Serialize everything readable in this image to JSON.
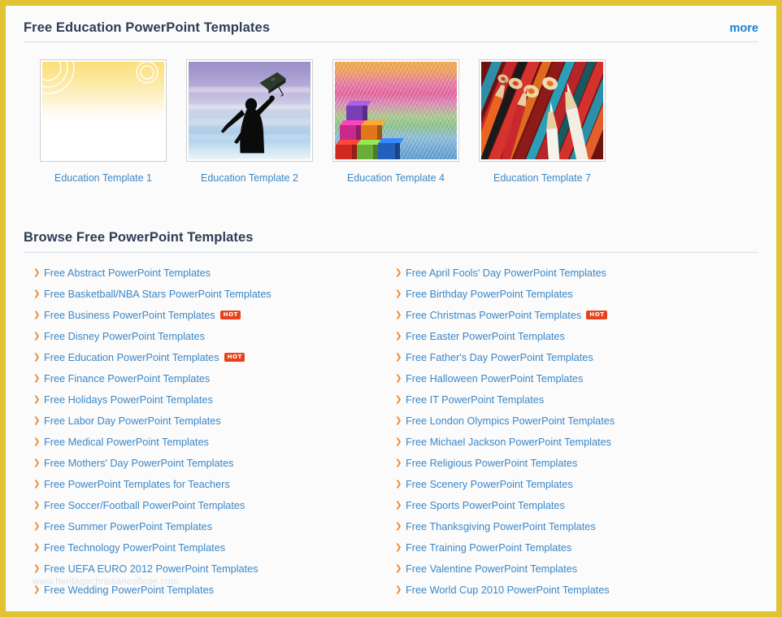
{
  "featured": {
    "title": "Free Education PowerPoint Templates",
    "more_label": "more",
    "more_color": "#1d7fd4",
    "thumbnails": [
      {
        "caption": "Education Template 1",
        "style": "yellow-swirl"
      },
      {
        "caption": "Education Template 2",
        "style": "graduate-silhouette"
      },
      {
        "caption": "Education Template 4",
        "style": "rainbow-blocks"
      },
      {
        "caption": "Education Template 7",
        "style": "colored-pencils"
      }
    ]
  },
  "browse": {
    "title": "Browse Free PowerPoint Templates",
    "bullet_glyph": "❯",
    "bullet_color": "#e8882a",
    "link_color": "#3b87c7",
    "hot_label": "HOT",
    "hot_color": "#e8421d",
    "left_column": [
      {
        "label": "Free Abstract PowerPoint Templates",
        "hot": false
      },
      {
        "label": "Free Basketball/NBA Stars PowerPoint Templates",
        "hot": false
      },
      {
        "label": "Free Business PowerPoint Templates",
        "hot": true
      },
      {
        "label": "Free Disney PowerPoint Templates",
        "hot": false
      },
      {
        "label": "Free Education PowerPoint Templates",
        "hot": true
      },
      {
        "label": "Free Finance PowerPoint Templates",
        "hot": false
      },
      {
        "label": "Free Holidays PowerPoint Templates",
        "hot": false
      },
      {
        "label": "Free Labor Day PowerPoint Templates",
        "hot": false
      },
      {
        "label": "Free Medical PowerPoint Templates",
        "hot": false
      },
      {
        "label": "Free Mothers' Day PowerPoint Templates",
        "hot": false
      },
      {
        "label": "Free PowerPoint Templates for Teachers",
        "hot": false
      },
      {
        "label": "Free Soccer/Football PowerPoint Templates",
        "hot": false
      },
      {
        "label": "Free Summer PowerPoint Templates",
        "hot": false
      },
      {
        "label": "Free Technology PowerPoint Templates",
        "hot": false
      },
      {
        "label": "Free UEFA EURO 2012 PowerPoint Templates",
        "hot": false
      },
      {
        "label": "Free Wedding PowerPoint Templates",
        "hot": false
      }
    ],
    "right_column": [
      {
        "label": "Free April Fools' Day PowerPoint Templates",
        "hot": false
      },
      {
        "label": "Free Birthday PowerPoint Templates",
        "hot": false
      },
      {
        "label": "Free Christmas PowerPoint Templates",
        "hot": true
      },
      {
        "label": "Free Easter PowerPoint Templates",
        "hot": false
      },
      {
        "label": "Free Father's Day PowerPoint Templates",
        "hot": false
      },
      {
        "label": "Free Halloween PowerPoint Templates",
        "hot": false
      },
      {
        "label": "Free IT PowerPoint Templates",
        "hot": false
      },
      {
        "label": "Free London Olympics PowerPoint Templates",
        "hot": false
      },
      {
        "label": "Free Michael Jackson PowerPoint Templates",
        "hot": false
      },
      {
        "label": "Free Religious PowerPoint Templates",
        "hot": false
      },
      {
        "label": "Free Scenery PowerPoint Templates",
        "hot": false
      },
      {
        "label": "Free Sports PowerPoint Templates",
        "hot": false
      },
      {
        "label": "Free Thanksgiving PowerPoint Templates",
        "hot": false
      },
      {
        "label": "Free Training PowerPoint Templates",
        "hot": false
      },
      {
        "label": "Free Valentine PowerPoint Templates",
        "hot": false
      },
      {
        "label": "Free World Cup 2010 PowerPoint Templates",
        "hot": false
      }
    ]
  },
  "watermark": {
    "text": "www.heritagechristiancollege.com"
  },
  "theme": {
    "border_color": "#e0c233",
    "page_background": "#fbfbfb",
    "heading_color": "#2e3d55"
  }
}
